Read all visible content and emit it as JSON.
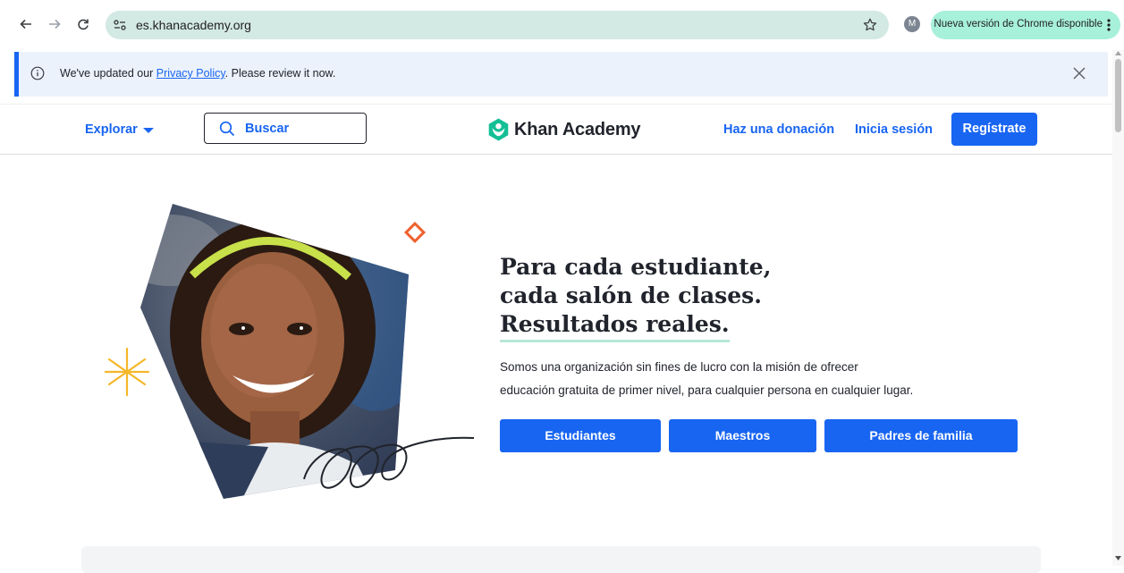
{
  "browser": {
    "url": "es.khanacademy.org",
    "profile_initial": "M",
    "update_label": "Nueva versión de Chrome disponible",
    "icons": [
      "back-arrow-icon",
      "forward-arrow-icon",
      "reload-icon",
      "site-settings-icon",
      "star-icon",
      "kebab-menu-icon"
    ]
  },
  "banner": {
    "text_before": "We've updated our ",
    "link_text": "Privacy Policy",
    "text_after": ". Please review it now."
  },
  "header": {
    "explore_label": "Explorar",
    "search_placeholder": "Buscar",
    "logo_text": "Khan Academy",
    "donate_label": "Haz una donación",
    "login_label": "Inicia sesión",
    "signup_label": "Regístrate"
  },
  "hero": {
    "headline_lines": [
      "Para cada estudiante,",
      "cada salón de clases.",
      "Resultados reales."
    ],
    "subtext_lines": [
      "Somos una organización sin fines de lucro con la misión de ofrecer",
      "educación gratuita de primer nivel, para cualquier persona en cualquier lugar."
    ],
    "buttons": [
      "Estudiantes",
      "Maestros",
      "Padres de familia"
    ]
  },
  "colors": {
    "accent": "#1865f2",
    "omnibox": "#d3e9e3",
    "update_pill": "#a7f0da",
    "banner_bg": "#ebf2fb",
    "logo_green": "#14bf96",
    "headline_underline": "#b9e7d7"
  }
}
